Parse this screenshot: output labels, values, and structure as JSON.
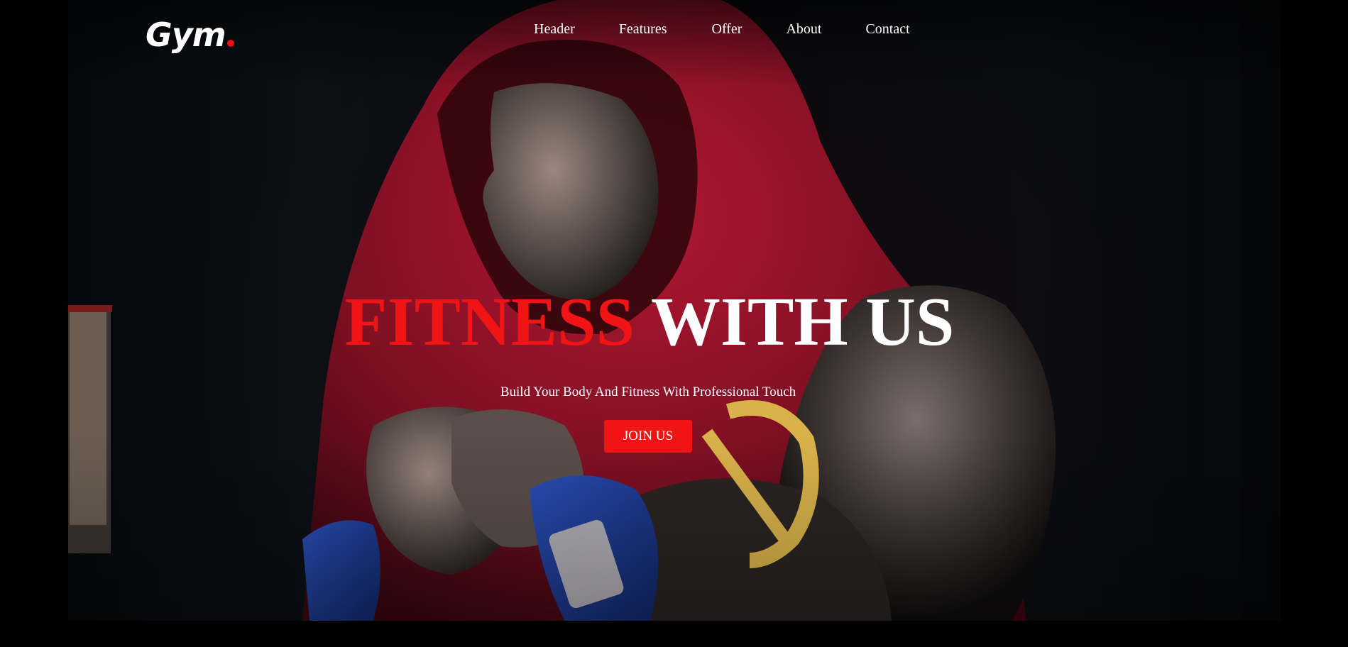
{
  "brand": {
    "logo_text": "Gym",
    "accent": "#f01414"
  },
  "nav": {
    "items": [
      {
        "label": "Header"
      },
      {
        "label": "Features"
      },
      {
        "label": "Offer"
      },
      {
        "label": "About"
      },
      {
        "label": "Contact"
      }
    ]
  },
  "hero": {
    "headline_red": "FITNESS",
    "headline_white": "WITH US",
    "subtitle": "Build Your Body And Fitness With Professional Touch",
    "cta_label": "JOIN US",
    "image": "hooded-boxer-photo"
  },
  "colors": {
    "background": "#000000",
    "hoodie": "#8c1024",
    "text": "#ffffff"
  }
}
